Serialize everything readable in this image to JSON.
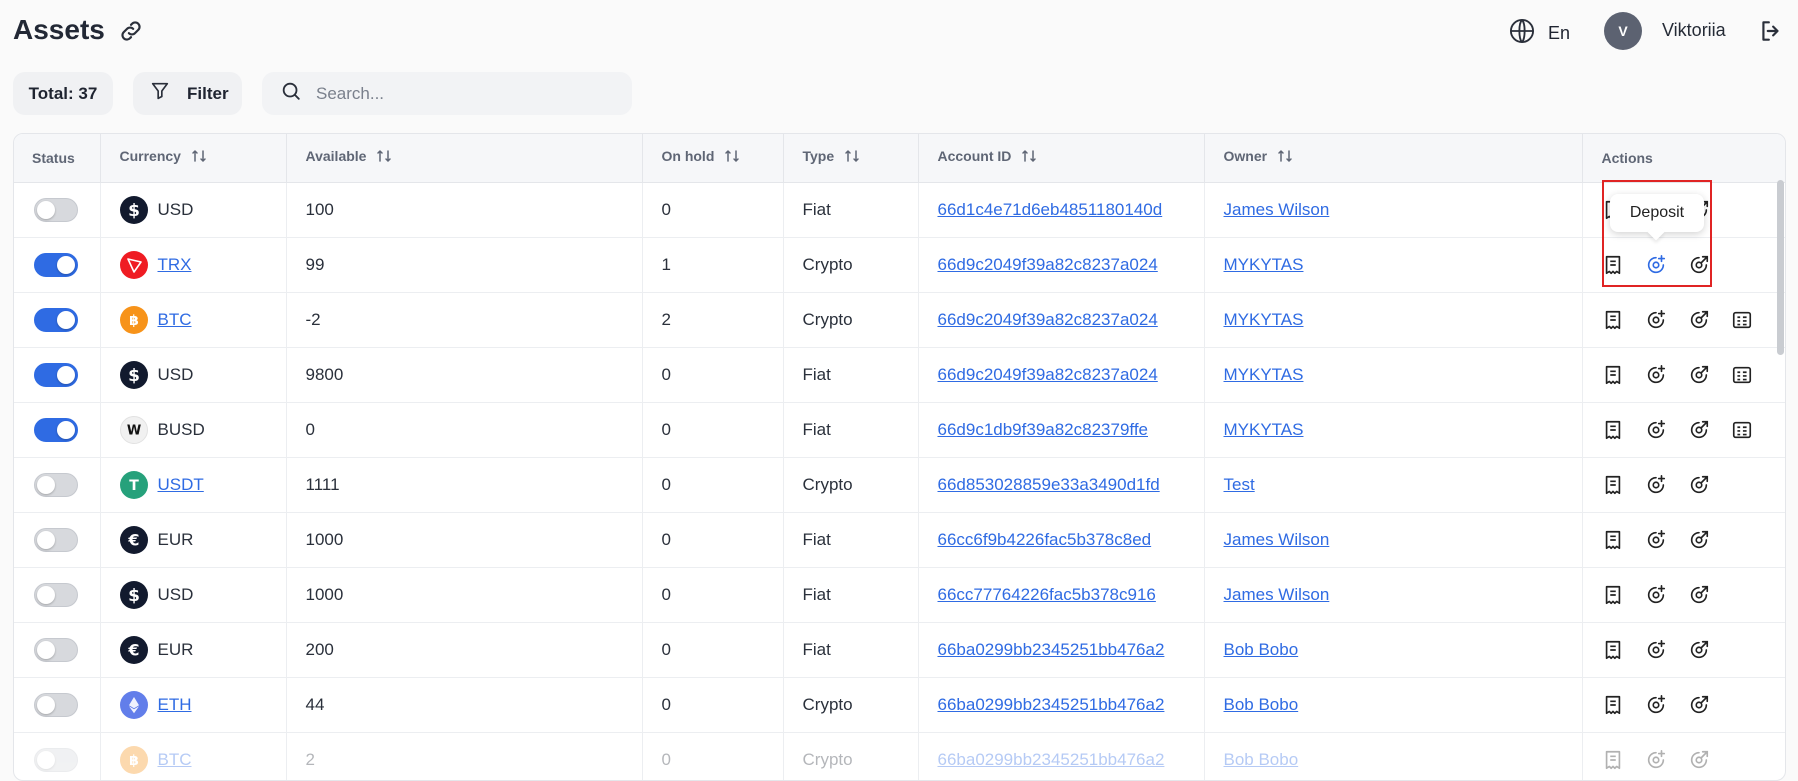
{
  "header": {
    "title": "Assets",
    "language": "En",
    "user_initial": "V",
    "user_name": "Viktoriia"
  },
  "toolbar": {
    "total": "Total: 37",
    "filter": "Filter",
    "search_placeholder": "Search..."
  },
  "columns": [
    "Status",
    "Currency",
    "Available",
    "On hold",
    "Type",
    "Account ID",
    "Owner",
    "Actions"
  ],
  "tooltip": "Deposit",
  "colors": {
    "accent": "#2f6be3",
    "highlight": "#e02424"
  },
  "rows": [
    {
      "status": "off",
      "coin": "usd",
      "currency": "USD",
      "linked": false,
      "available": "100",
      "on_hold": "0",
      "type": "Fiat",
      "account_id": "66d1c4e71d6eb4851180140d",
      "owner": "James Wilson",
      "actions": 3
    },
    {
      "status": "on",
      "coin": "trx",
      "currency": "TRX",
      "linked": true,
      "available": "99",
      "on_hold": "1",
      "type": "Crypto",
      "account_id": "66d9c2049f39a82c8237a024",
      "owner": "MYKYTAS",
      "actions": 3
    },
    {
      "status": "on",
      "coin": "btc",
      "currency": "BTC",
      "linked": true,
      "available": "-2",
      "on_hold": "2",
      "type": "Crypto",
      "account_id": "66d9c2049f39a82c8237a024",
      "owner": "MYKYTAS",
      "actions": 4
    },
    {
      "status": "on",
      "coin": "usd",
      "currency": "USD",
      "linked": false,
      "available": "9800",
      "on_hold": "0",
      "type": "Fiat",
      "account_id": "66d9c2049f39a82c8237a024",
      "owner": "MYKYTAS",
      "actions": 4
    },
    {
      "status": "on",
      "coin": "busd",
      "currency": "BUSD",
      "linked": false,
      "available": "0",
      "on_hold": "0",
      "type": "Fiat",
      "account_id": "66d9c1db9f39a82c82379ffe",
      "owner": "MYKYTAS",
      "actions": 4
    },
    {
      "status": "off",
      "coin": "usdt",
      "currency": "USDT",
      "linked": true,
      "available": "1111",
      "on_hold": "0",
      "type": "Crypto",
      "account_id": "66d853028859e33a3490d1fd",
      "owner": "Test",
      "actions": 3
    },
    {
      "status": "off",
      "coin": "eur",
      "currency": "EUR",
      "linked": false,
      "available": "1000",
      "on_hold": "0",
      "type": "Fiat",
      "account_id": "66cc6f9b4226fac5b378c8ed",
      "owner": "James Wilson",
      "actions": 3
    },
    {
      "status": "off",
      "coin": "usd",
      "currency": "USD",
      "linked": false,
      "available": "1000",
      "on_hold": "0",
      "type": "Fiat",
      "account_id": "66cc77764226fac5b378c916",
      "owner": "James Wilson",
      "actions": 3
    },
    {
      "status": "off",
      "coin": "eur",
      "currency": "EUR",
      "linked": false,
      "available": "200",
      "on_hold": "0",
      "type": "Fiat",
      "account_id": "66ba0299bb2345251bb476a2",
      "owner": "Bob Bobo",
      "actions": 3
    },
    {
      "status": "off",
      "coin": "eth",
      "currency": "ETH",
      "linked": true,
      "available": "44",
      "on_hold": "0",
      "type": "Crypto",
      "account_id": "66ba0299bb2345251bb476a2",
      "owner": "Bob Bobo",
      "actions": 3
    },
    {
      "status": "off",
      "coin": "btc",
      "currency": "BTC",
      "linked": true,
      "available": "2",
      "on_hold": "0",
      "type": "Crypto",
      "account_id": "66ba0299bb2345251bb476a2",
      "owner": "Bob Bobo",
      "actions": 3,
      "faded": true
    }
  ]
}
